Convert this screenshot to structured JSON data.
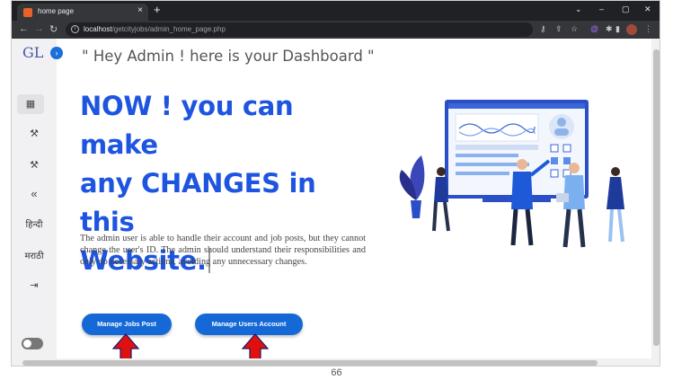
{
  "browser": {
    "tab_title": "home page",
    "tab_close": "×",
    "new_tab": "+",
    "url_host": "localhost",
    "url_path": "/getcityjobs/admin_home_page.php",
    "window_controls": [
      "⌄",
      "–",
      "▢",
      "✕"
    ]
  },
  "sidebar": {
    "logo_text": "GL",
    "expand_icon": "›",
    "items": [
      {
        "icon": "dashboard-icon",
        "glyph": "▦"
      },
      {
        "icon": "wrench-icon",
        "glyph": "⚒"
      },
      {
        "icon": "wrench-icon",
        "glyph": "⚒"
      },
      {
        "icon": "double-chevron-left-icon",
        "glyph": "«"
      },
      {
        "label": "हिन्दी"
      },
      {
        "label": "मराठी"
      },
      {
        "icon": "logout-icon",
        "glyph": "⇥"
      }
    ]
  },
  "main": {
    "greeting": "\" Hey Admin ! here is your Dashboard \"",
    "headline_line1": "NOW ! you can make",
    "headline_line2": "any CHANGES in this",
    "headline_line3": "Website.",
    "description": "The admin user is able to handle their account and job posts, but they cannot change the user's ID. The admin should understand their responsibilities and only do necessary actions, avoiding any unnecessary changes.",
    "btn_jobs": "Manage Jobs Post",
    "btn_users": "Manage Users Account"
  },
  "footer": {
    "page_number": "66"
  },
  "colors": {
    "accent": "#1e55e0",
    "button": "#1469d7",
    "arrow": "#e01010"
  }
}
